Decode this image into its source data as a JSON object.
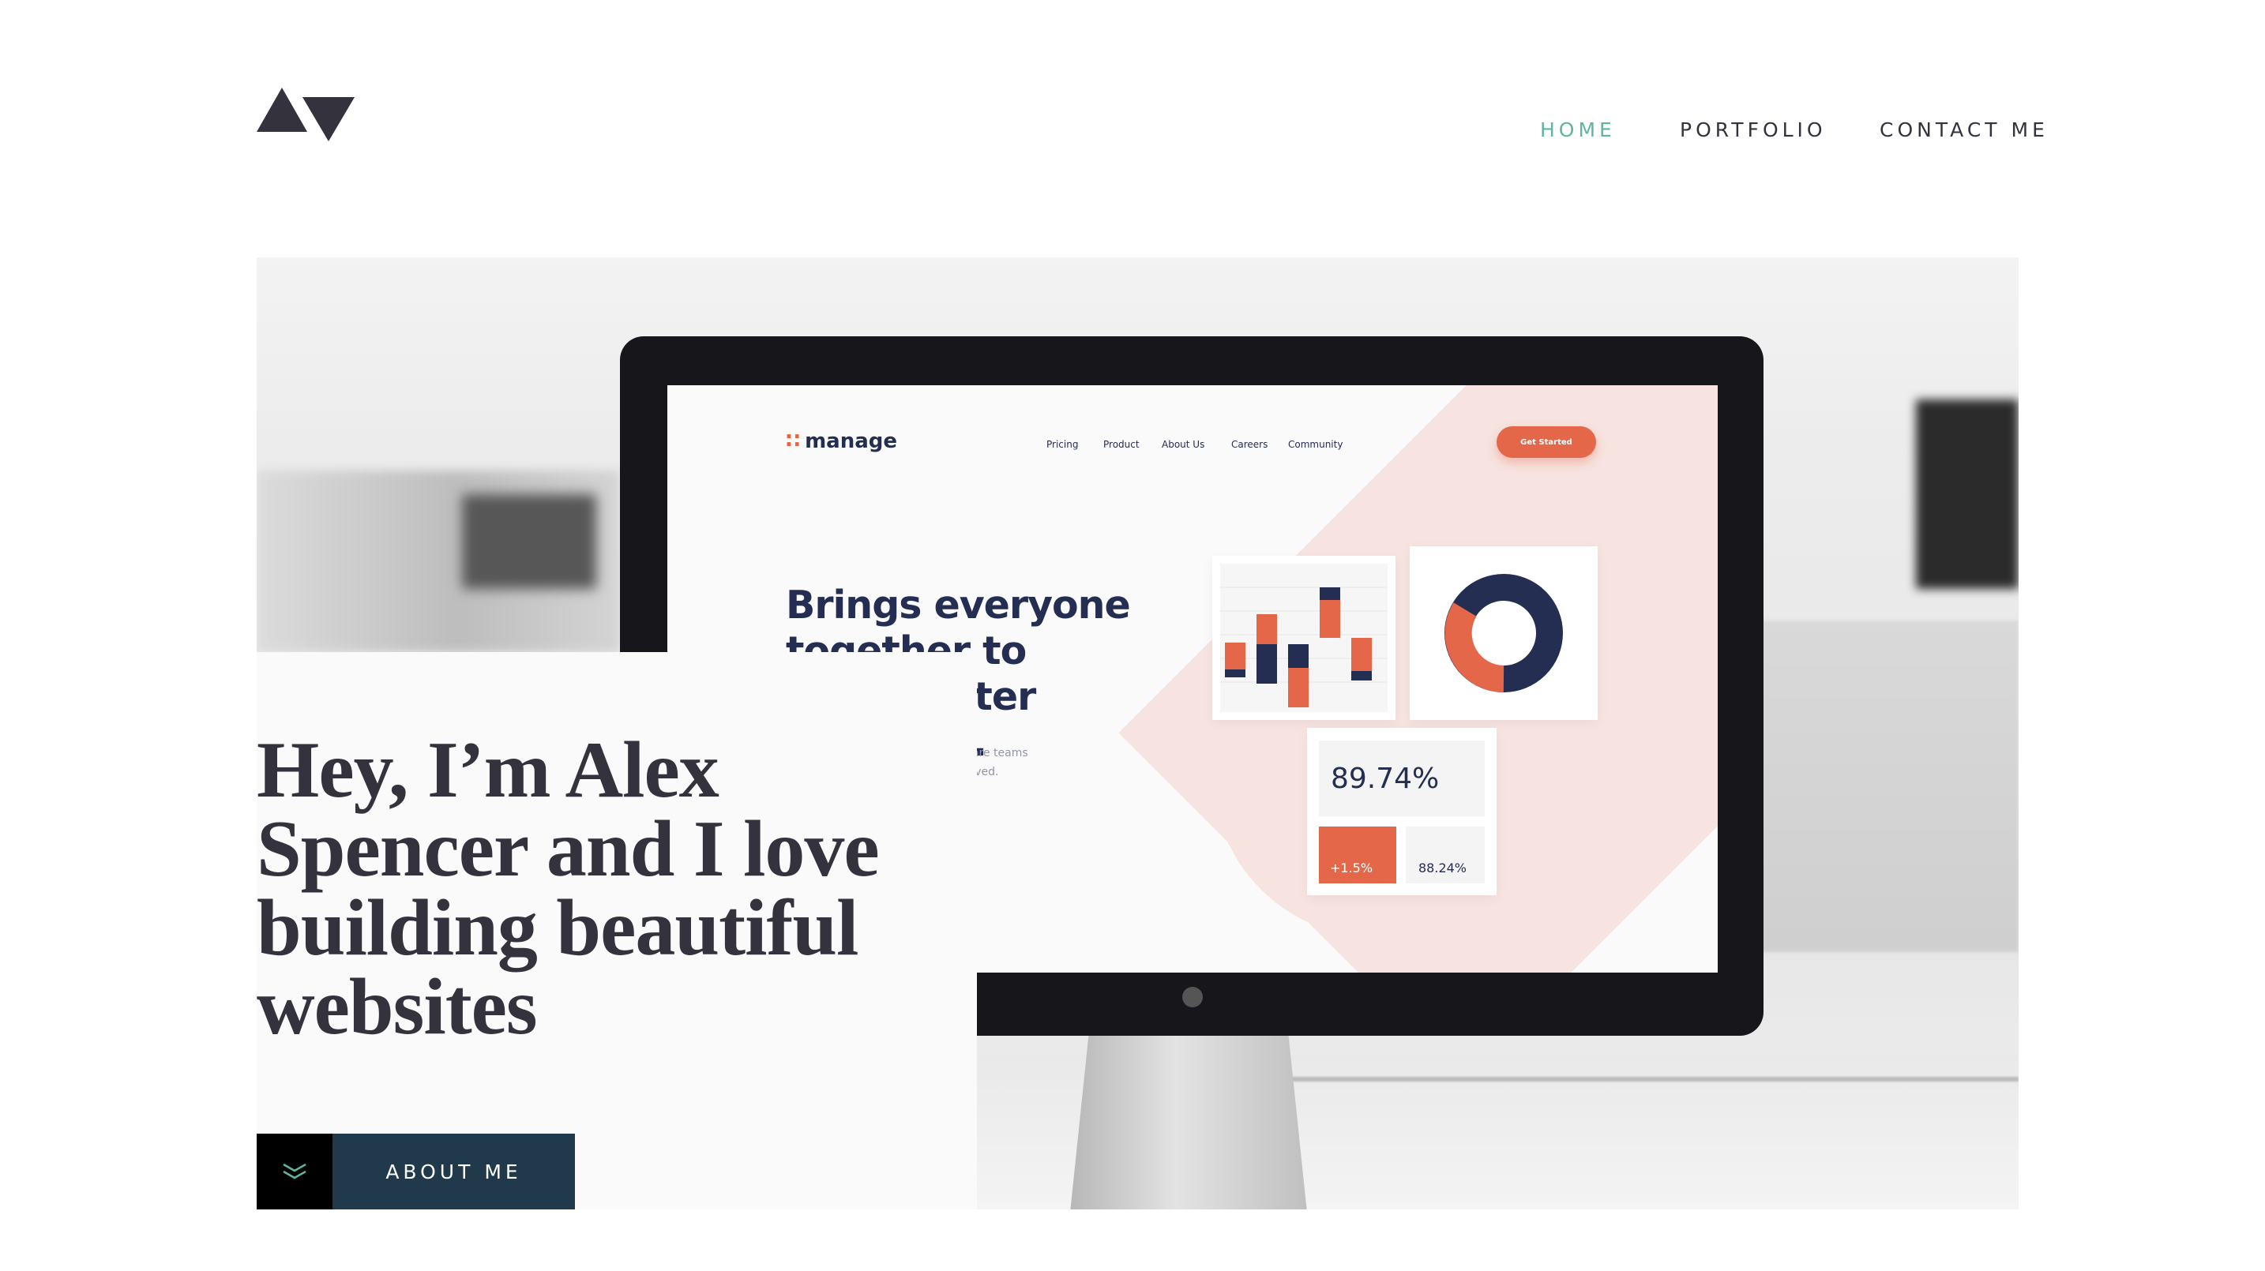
{
  "header": {
    "logo_icon": "av-triangles-logo-icon",
    "nav": {
      "home": "HOME",
      "portfolio": "PORTFOLIO",
      "contact": "CONTACT ME"
    },
    "active_color": "#5fb4a2",
    "text_color": "#33323d"
  },
  "hero": {
    "headline": "Hey, I’m Alex Spencer and I love building beautiful websites",
    "about_button": "ABOUT ME",
    "about_icon": "double-chevron-down-icon",
    "button_color": "#203a4c"
  },
  "mockup": {
    "brand": "manage",
    "nav": [
      "Pricing",
      "Product",
      "About Us",
      "Careers",
      "Community"
    ],
    "cta": "Get Started",
    "heading": "Brings everyone together to build better products.",
    "subtext": "Manage makes it simple for software teams to plan day-to-day tasks are achieved.",
    "stat_main": "89.74%",
    "stat_change": "+1.5%",
    "stat_secondary": "88.24%",
    "accent_color": "#e4674a",
    "navy_color": "#242d52"
  }
}
